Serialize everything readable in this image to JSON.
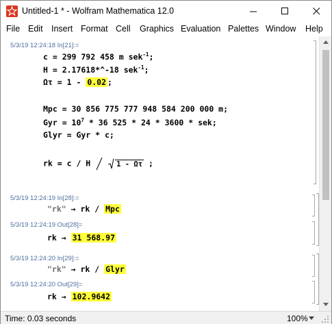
{
  "window": {
    "title": "Untitled-1 * - Wolfram Mathematica 12.0"
  },
  "menu": [
    "File",
    "Edit",
    "Insert",
    "Format",
    "Cell",
    "Graphics",
    "Evaluation",
    "Palettes",
    "Window",
    "Help"
  ],
  "cells": {
    "in21": {
      "label": "5/3/19 12:24:18 In[21]:=",
      "c_pre": "c = 299 792 458 m sek",
      "c_exp": "-1",
      "c_post": ";",
      "h_pre": "H = 2.17618*^-18 sek",
      "h_exp": "-1",
      "h_post": ";",
      "omega_pre": "Ωτ = 1 - ",
      "omega_val": "0.02",
      "omega_post": ";",
      "mpc": "Mpc = 30 856 775 777 948 584 200 000 m;",
      "gyr_pre": "Gyr = 10",
      "gyr_exp": "7",
      "gyr_post": " * 36 525 * 24 * 3600 * sek;",
      "glyr": "Glyr = Gyr * c;",
      "rk_pre": "rk = c / H",
      "rk_radicand": "1 - Ωτ",
      "rk_post": " ;"
    },
    "in28": {
      "label": "5/3/19 12:24:19 In[28]:=",
      "str": "\"rk\"",
      "mid": " → rk / ",
      "hl": "Mpc"
    },
    "out28": {
      "label": "5/3/19 12:24:19 Out[28]=",
      "pre": "rk → ",
      "hl": "31 568.97"
    },
    "in29": {
      "label": "5/3/19 12:24:20 In[29]:=",
      "str": "\"rk\"",
      "mid": " → rk / ",
      "hl": "Glyr"
    },
    "out29": {
      "label": "5/3/19 12:24:20 Out[29]=",
      "pre": "rk → ",
      "hl": "102.9642"
    }
  },
  "status": {
    "text": "Time: 0.03 seconds",
    "zoom": "100%"
  },
  "colors": {
    "highlight": "#ffff3b",
    "label": "#4d6e9e",
    "icon": "#d9371f"
  }
}
